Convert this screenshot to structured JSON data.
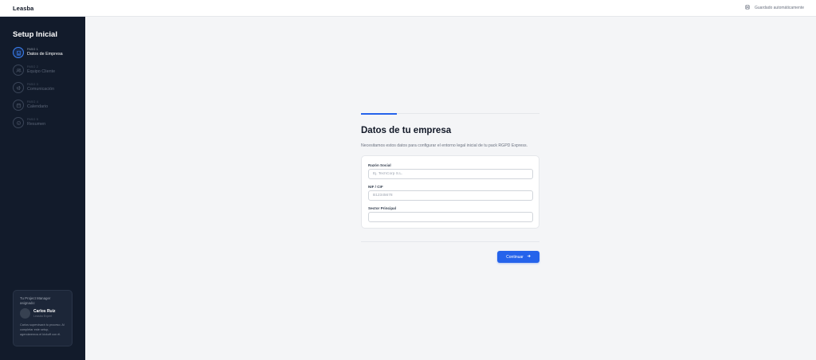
{
  "header": {
    "logo": "Leasba",
    "autosave_label": "Guardado automáticamente",
    "autosave_icon": "save-icon"
  },
  "sidebar": {
    "title": "Setup Inicial",
    "steps": [
      {
        "number": "PASO 1",
        "label": "Datos de Empresa",
        "icon": "building-icon",
        "active": true
      },
      {
        "number": "PASO 2",
        "label": "Equipo Cliente",
        "icon": "users-icon",
        "active": false
      },
      {
        "number": "PASO 3",
        "label": "Comunicación",
        "icon": "megaphone-icon",
        "active": false
      },
      {
        "number": "PASO 4",
        "label": "Calendario",
        "icon": "calendar-icon",
        "active": false
      },
      {
        "number": "PASO 5",
        "label": "Resumen",
        "icon": "check-circle-icon",
        "active": false
      }
    ],
    "pm_card": {
      "heading": "Tu Project Manager asignado:",
      "name": "Carlos Ruiz",
      "role": "Leasba Expert",
      "description": "Carlos supervisará tu proceso. Al completar este setup, agendaremos el kickoff con él."
    }
  },
  "main": {
    "progress": 0.2,
    "title": "Datos de tu empresa",
    "subtitle": "Necesitamos estos datos para configurar el entorno legal inicial de tu pack RGPD Express.",
    "fields": [
      {
        "label": "Razón Social",
        "value": "",
        "placeholder": "Ej. TechCorp S.L."
      },
      {
        "label": "NIF / CIF",
        "value": "",
        "placeholder": "B12345678"
      },
      {
        "label": "Sector Principal",
        "value": "",
        "placeholder": ""
      }
    ],
    "continue_label": "Continuar",
    "continue_icon": "arrow-right-icon"
  },
  "colors": {
    "sidebar_bg": "#121b2b",
    "accent": "#2563eb",
    "page_bg": "#f4f5f7"
  }
}
